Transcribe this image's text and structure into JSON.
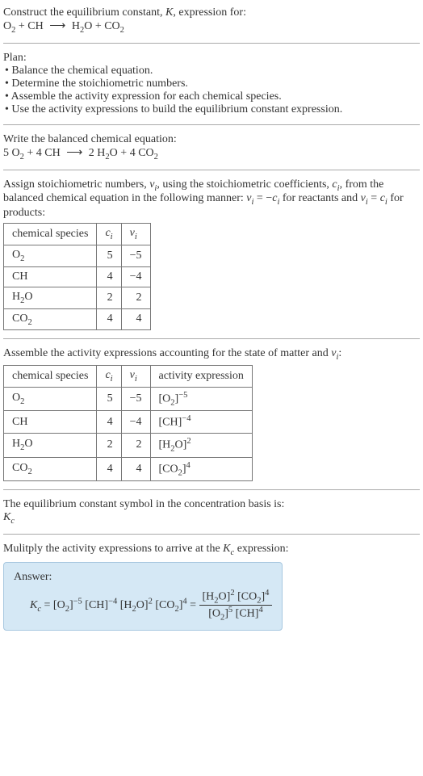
{
  "intro": {
    "line1": "Construct the equilibrium constant, ",
    "K": "K",
    "line1_end": ", expression for:",
    "equation_lhs1": "O",
    "equation_lhs1_sub": "2",
    "plus": " + ",
    "equation_lhs2": "CH",
    "arrow": "⟶",
    "equation_rhs1": "H",
    "equation_rhs1_sub": "2",
    "equation_rhs1_end": "O",
    "equation_rhs2": "CO",
    "equation_rhs2_sub": "2"
  },
  "plan": {
    "title": "Plan:",
    "b1": "Balance the chemical equation.",
    "b2": "Determine the stoichiometric numbers.",
    "b3": "Assemble the activity expression for each chemical species.",
    "b4": "Use the activity expressions to build the equilibrium constant expression."
  },
  "balanced": {
    "title": "Write the balanced chemical equation:",
    "c1": "5 O",
    "c1_sub": "2",
    "c2": " + 4 CH",
    "arrow": "⟶",
    "c3": "2 H",
    "c3_sub": "2",
    "c3_end": "O",
    "c4": " + 4 CO",
    "c4_sub": "2"
  },
  "stoich": {
    "text1": "Assign stoichiometric numbers, ",
    "nu": "ν",
    "i": "i",
    "text2": ", using the stoichiometric coefficients, ",
    "c": "c",
    "text3": ", from the balanced chemical equation in the following manner: ",
    "nu_eq": "ν",
    "eq1": " = −",
    "text4": " for reactants and ",
    "eq2": " = ",
    "text5": " for products:",
    "table": {
      "h1": "chemical species",
      "h2_c": "c",
      "h2_i": "i",
      "h3_nu": "ν",
      "h3_i": "i",
      "rows": [
        {
          "species_base": "O",
          "species_sub": "2",
          "c": "5",
          "nu": "−5"
        },
        {
          "species_base": "CH",
          "species_sub": "",
          "c": "4",
          "nu": "−4"
        },
        {
          "species_base": "H",
          "species_sub": "2",
          "species_end": "O",
          "c": "2",
          "nu": "2"
        },
        {
          "species_base": "CO",
          "species_sub": "2",
          "c": "4",
          "nu": "4"
        }
      ]
    }
  },
  "activity": {
    "text1": "Assemble the activity expressions accounting for the state of matter and ",
    "nu": "ν",
    "i": "i",
    "colon": ":",
    "table": {
      "h1": "chemical species",
      "h2_c": "c",
      "h2_i": "i",
      "h3_nu": "ν",
      "h3_i": "i",
      "h4": "activity expression",
      "rows": [
        {
          "species_base": "O",
          "species_sub": "2",
          "c": "5",
          "nu": "−5",
          "expr_base": "[O",
          "expr_sub": "2",
          "expr_mid": "]",
          "expr_sup": "−5"
        },
        {
          "species_base": "CH",
          "species_sub": "",
          "c": "4",
          "nu": "−4",
          "expr_base": "[CH]",
          "expr_sub": "",
          "expr_mid": "",
          "expr_sup": "−4"
        },
        {
          "species_base": "H",
          "species_sub": "2",
          "species_end": "O",
          "c": "2",
          "nu": "2",
          "expr_base": "[H",
          "expr_sub": "2",
          "expr_mid": "O]",
          "expr_sup": "2"
        },
        {
          "species_base": "CO",
          "species_sub": "2",
          "c": "4",
          "nu": "4",
          "expr_base": "[CO",
          "expr_sub": "2",
          "expr_mid": "]",
          "expr_sup": "4"
        }
      ]
    }
  },
  "symbol": {
    "text": "The equilibrium constant symbol in the concentration basis is:",
    "K": "K",
    "c": "c"
  },
  "multiply": {
    "text1": "Mulitply the activity expressions to arrive at the ",
    "K": "K",
    "c": "c",
    "text2": " expression:"
  },
  "answer": {
    "title": "Answer:",
    "K": "K",
    "c": "c",
    "eq": " = ",
    "t1": "[O",
    "t1_sub": "2",
    "t1_end": "]",
    "t1_sup": "−5",
    "t2": " [CH]",
    "t2_sup": "−4",
    "t3": " [H",
    "t3_sub": "2",
    "t3_end": "O]",
    "t3_sup": "2",
    "t4": " [CO",
    "t4_sub": "2",
    "t4_end": "]",
    "t4_sup": "4",
    "eq2": " = ",
    "num1": "[H",
    "num1_sub": "2",
    "num1_end": "O]",
    "num1_sup": "2",
    "num2": " [CO",
    "num2_sub": "2",
    "num2_end": "]",
    "num2_sup": "4",
    "den1": "[O",
    "den1_sub": "2",
    "den1_end": "]",
    "den1_sup": "5",
    "den2": " [CH]",
    "den2_sup": "4"
  }
}
